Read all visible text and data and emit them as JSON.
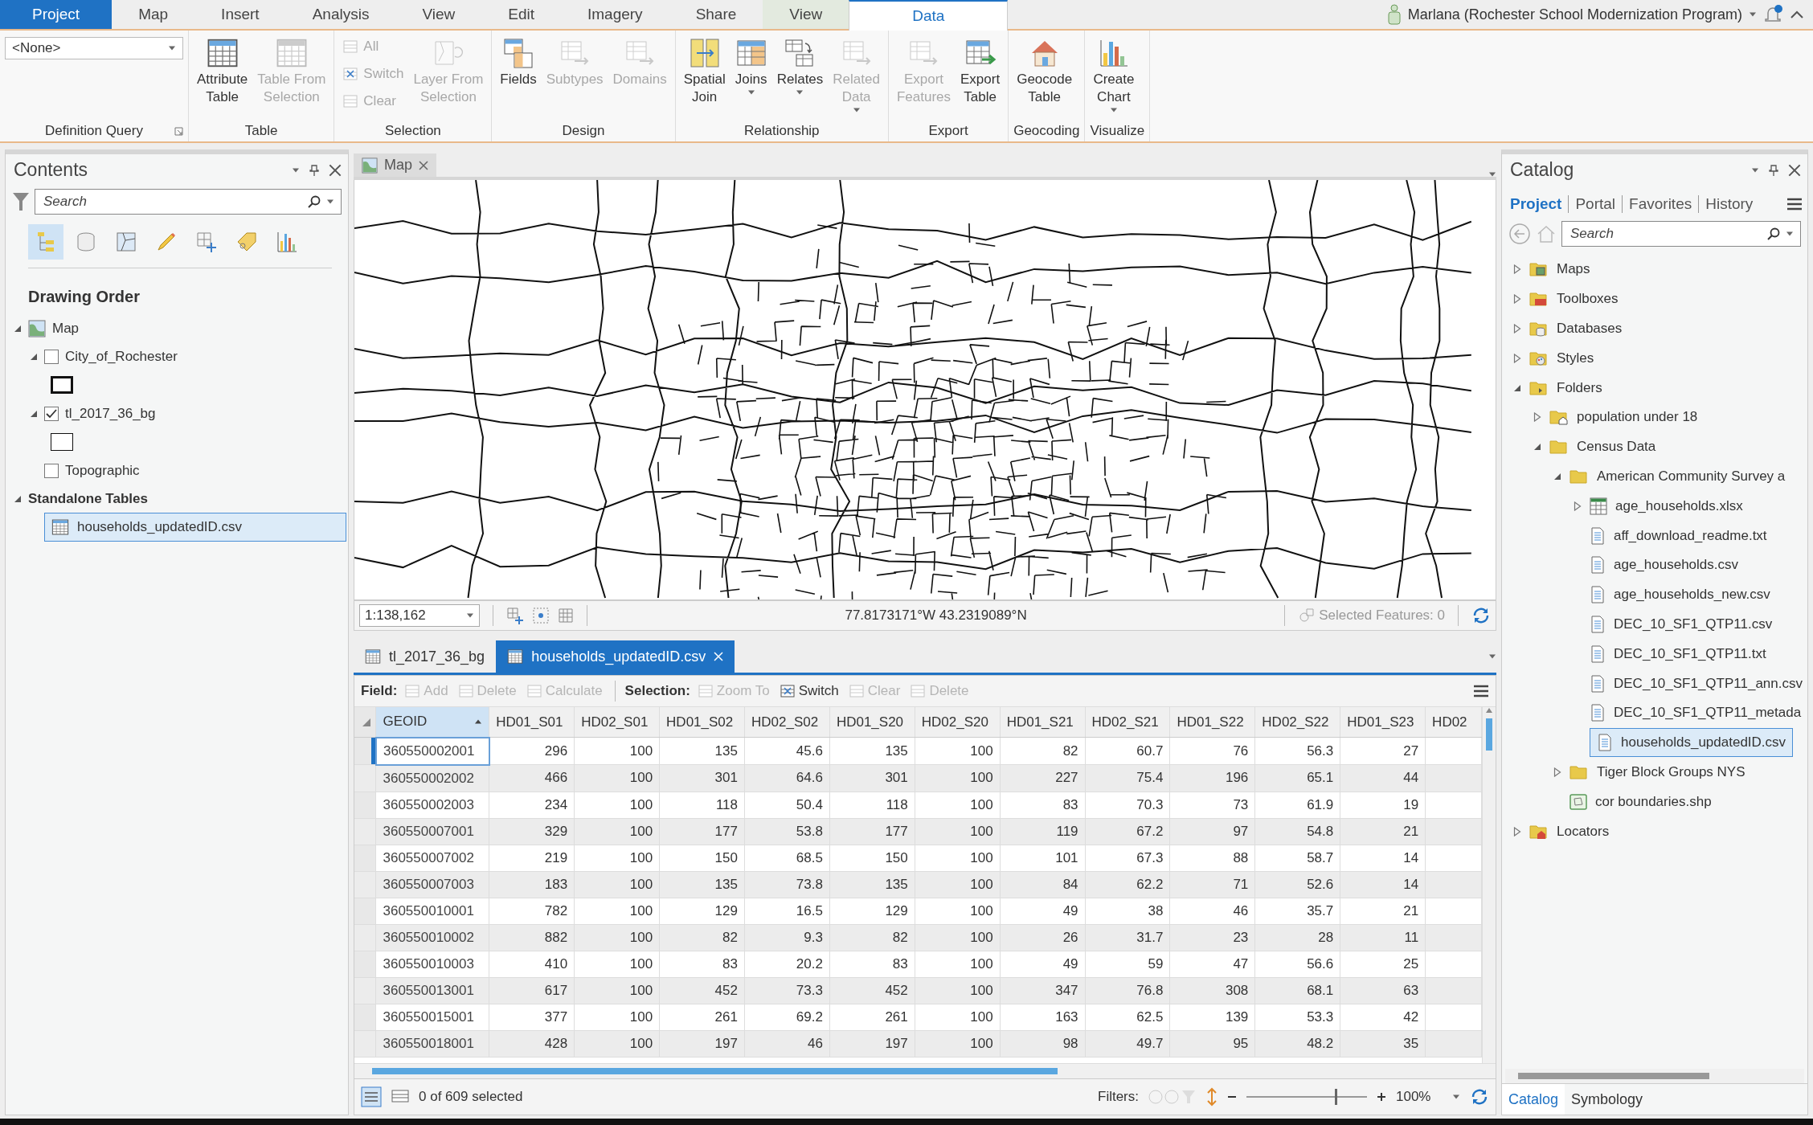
{
  "ribbon_tabs": [
    {
      "label": "Project",
      "kind": "file",
      "selected": false
    },
    {
      "label": "Map",
      "kind": "normal",
      "selected": false
    },
    {
      "label": "Insert",
      "kind": "normal",
      "selected": false
    },
    {
      "label": "Analysis",
      "kind": "normal",
      "selected": false
    },
    {
      "label": "View",
      "kind": "normal",
      "selected": false
    },
    {
      "label": "Edit",
      "kind": "normal",
      "selected": false
    },
    {
      "label": "Imagery",
      "kind": "normal",
      "selected": false
    },
    {
      "label": "Share",
      "kind": "normal",
      "selected": false
    },
    {
      "label": "View",
      "kind": "contextual",
      "selected": false
    },
    {
      "label": "Data",
      "kind": "contextual",
      "selected": true
    }
  ],
  "user": {
    "name": "Marlana (Rochester School Modernization Program)",
    "notification": true
  },
  "ribbon_groups": [
    {
      "label": "Definition Query",
      "launcher": true,
      "controls": [
        {
          "kind": "dropdown",
          "value": "<None>"
        }
      ]
    },
    {
      "label": "Table",
      "controls": [
        {
          "kind": "large",
          "lines": [
            "Attribute",
            "Table"
          ],
          "disabled": false
        },
        {
          "kind": "large",
          "lines": [
            "Table From",
            "Selection"
          ],
          "disabled": true
        }
      ]
    },
    {
      "label": "Selection",
      "controls": [
        {
          "kind": "stack",
          "items": [
            {
              "label": "All",
              "disabled": true
            },
            {
              "label": "Switch",
              "disabled": true
            },
            {
              "label": "Clear",
              "disabled": true
            }
          ]
        },
        {
          "kind": "large",
          "lines": [
            "Layer From",
            "Selection"
          ],
          "disabled": true
        }
      ]
    },
    {
      "label": "Design",
      "controls": [
        {
          "kind": "large",
          "lines": [
            "Fields"
          ],
          "disabled": false
        },
        {
          "kind": "large",
          "lines": [
            "Subtypes"
          ],
          "disabled": true
        },
        {
          "kind": "large",
          "lines": [
            "Domains"
          ],
          "disabled": true
        }
      ]
    },
    {
      "label": "Relationship",
      "controls": [
        {
          "kind": "large",
          "lines": [
            "Spatial",
            "Join"
          ],
          "disabled": false
        },
        {
          "kind": "large",
          "lines": [
            "Joins"
          ],
          "disabled": false,
          "menu": true
        },
        {
          "kind": "large",
          "lines": [
            "Relates"
          ],
          "disabled": false,
          "menu": true
        },
        {
          "kind": "large",
          "lines": [
            "Related",
            "Data"
          ],
          "disabled": true,
          "menu": true
        }
      ]
    },
    {
      "label": "Export",
      "controls": [
        {
          "kind": "large",
          "lines": [
            "Export",
            "Features"
          ],
          "disabled": true
        },
        {
          "kind": "large",
          "lines": [
            "Export",
            "Table"
          ],
          "disabled": false
        }
      ]
    },
    {
      "label": "Geocoding",
      "controls": [
        {
          "kind": "large",
          "lines": [
            "Geocode",
            "Table"
          ],
          "disabled": false
        }
      ]
    },
    {
      "label": "Visualize",
      "controls": [
        {
          "kind": "large",
          "lines": [
            "Create",
            "Chart"
          ],
          "disabled": false,
          "menu": true
        }
      ]
    }
  ],
  "contents": {
    "title": "Contents",
    "search": {
      "placeholder": "Search"
    },
    "view_tabs": [
      {
        "selected": true
      },
      {
        "selected": false
      },
      {
        "selected": false
      },
      {
        "selected": false
      },
      {
        "selected": false
      },
      {
        "selected": false
      },
      {
        "selected": false
      }
    ],
    "heading": "Drawing Order",
    "tree": [
      {
        "label": "Map",
        "kind": "map",
        "expanded": true,
        "selected": false,
        "children": [
          {
            "label": "City_of_Rochester",
            "kind": "layer",
            "expanded": true,
            "checked": false,
            "outline_bold": true,
            "selected": false
          },
          {
            "label": "tl_2017_36_bg",
            "kind": "layer",
            "expanded": true,
            "checked": true,
            "outline_bold": false,
            "selected": false
          },
          {
            "label": "Topographic",
            "kind": "basemap",
            "checked": false,
            "selected": false
          }
        ]
      },
      {
        "label": "Standalone Tables",
        "kind": "group",
        "expanded": true,
        "selected": false,
        "children": [
          {
            "label": "households_updatedID.csv",
            "kind": "table",
            "selected": true
          }
        ]
      }
    ]
  },
  "map": {
    "tab": {
      "label": "Map"
    },
    "scale": "1:138,162",
    "coordinates": "77.8173171°W 43.2319089°N",
    "selected_features": "Selected Features: 0",
    "kind": "picture"
  },
  "table": {
    "tabs": [
      {
        "label": "tl_2017_36_bg",
        "selected": false
      },
      {
        "label": "households_updatedID.csv",
        "selected": true
      }
    ],
    "toolbar": {
      "field_label": "Field:",
      "field_buttons": [
        {
          "label": "Add",
          "disabled": true
        },
        {
          "label": "Delete",
          "disabled": true
        },
        {
          "label": "Calculate",
          "disabled": true
        }
      ],
      "selection_label": "Selection:",
      "selection_buttons": [
        {
          "label": "Zoom To",
          "disabled": true
        },
        {
          "label": "Switch",
          "disabled": false
        },
        {
          "label": "Clear",
          "disabled": true
        },
        {
          "label": "Delete",
          "disabled": true
        }
      ]
    },
    "columns": [
      {
        "label": "GEOID",
        "sorted": true
      },
      {
        "label": "HD01_S01",
        "sorted": false
      },
      {
        "label": "HD02_S01",
        "sorted": false
      },
      {
        "label": "HD01_S02",
        "sorted": false
      },
      {
        "label": "HD02_S02",
        "sorted": false
      },
      {
        "label": "HD01_S20",
        "sorted": false
      },
      {
        "label": "HD02_S20",
        "sorted": false
      },
      {
        "label": "HD01_S21",
        "sorted": false
      },
      {
        "label": "HD02_S21",
        "sorted": false
      },
      {
        "label": "HD01_S22",
        "sorted": false
      },
      {
        "label": "HD02_S22",
        "sorted": false
      },
      {
        "label": "HD01_S23",
        "sorted": false
      },
      {
        "label": "HD02",
        "sorted": false
      }
    ],
    "rows": [
      {
        "current": true,
        "cells": [
          "360550002001",
          "296",
          "100",
          "135",
          "45.6",
          "135",
          "100",
          "82",
          "60.7",
          "76",
          "56.3",
          "27"
        ]
      },
      {
        "current": false,
        "cells": [
          "360550002002",
          "466",
          "100",
          "301",
          "64.6",
          "301",
          "100",
          "227",
          "75.4",
          "196",
          "65.1",
          "44"
        ]
      },
      {
        "current": false,
        "cells": [
          "360550002003",
          "234",
          "100",
          "118",
          "50.4",
          "118",
          "100",
          "83",
          "70.3",
          "73",
          "61.9",
          "19"
        ]
      },
      {
        "current": false,
        "cells": [
          "360550007001",
          "329",
          "100",
          "177",
          "53.8",
          "177",
          "100",
          "119",
          "67.2",
          "97",
          "54.8",
          "21"
        ]
      },
      {
        "current": false,
        "cells": [
          "360550007002",
          "219",
          "100",
          "150",
          "68.5",
          "150",
          "100",
          "101",
          "67.3",
          "88",
          "58.7",
          "14"
        ]
      },
      {
        "current": false,
        "cells": [
          "360550007003",
          "183",
          "100",
          "135",
          "73.8",
          "135",
          "100",
          "84",
          "62.2",
          "71",
          "52.6",
          "14"
        ]
      },
      {
        "current": false,
        "cells": [
          "360550010001",
          "782",
          "100",
          "129",
          "16.5",
          "129",
          "100",
          "49",
          "38",
          "46",
          "35.7",
          "21"
        ]
      },
      {
        "current": false,
        "cells": [
          "360550010002",
          "882",
          "100",
          "82",
          "9.3",
          "82",
          "100",
          "26",
          "31.7",
          "23",
          "28",
          "11"
        ]
      },
      {
        "current": false,
        "cells": [
          "360550010003",
          "410",
          "100",
          "83",
          "20.2",
          "83",
          "100",
          "49",
          "59",
          "47",
          "56.6",
          "25"
        ]
      },
      {
        "current": false,
        "cells": [
          "360550013001",
          "617",
          "100",
          "452",
          "73.3",
          "452",
          "100",
          "347",
          "76.8",
          "308",
          "68.1",
          "63"
        ]
      },
      {
        "current": false,
        "cells": [
          "360550015001",
          "377",
          "100",
          "261",
          "69.2",
          "261",
          "100",
          "163",
          "62.5",
          "139",
          "53.3",
          "42"
        ]
      },
      {
        "current": false,
        "cells": [
          "360550018001",
          "428",
          "100",
          "197",
          "46",
          "197",
          "100",
          "98",
          "49.7",
          "95",
          "48.2",
          "35"
        ]
      }
    ],
    "footer": {
      "selected": "0 of 609 selected",
      "filters_label": "Filters:",
      "zoom": {
        "level": 0.73
      },
      "zoom_value": "100%"
    }
  },
  "catalog": {
    "title": "Catalog",
    "tabs": [
      {
        "label": "Project",
        "selected": true
      },
      {
        "label": "Portal",
        "selected": false
      },
      {
        "label": "Favorites",
        "selected": false
      },
      {
        "label": "History",
        "selected": false
      }
    ],
    "search": {
      "placeholder": "Search"
    },
    "tree": [
      {
        "label": "Maps",
        "kind": "maps",
        "expanded": false,
        "selected": false
      },
      {
        "label": "Toolboxes",
        "kind": "toolboxes",
        "expanded": false,
        "selected": false
      },
      {
        "label": "Databases",
        "kind": "databases",
        "expanded": false,
        "selected": false
      },
      {
        "label": "Styles",
        "kind": "styles",
        "expanded": false,
        "selected": false
      },
      {
        "label": "Folders",
        "kind": "folders",
        "expanded": true,
        "selected": false,
        "children": [
          {
            "label": "population under 18",
            "kind": "home_folder",
            "expanded": false,
            "selected": false
          },
          {
            "label": "Census Data",
            "kind": "folder",
            "expanded": true,
            "selected": false,
            "children": [
              {
                "label": "American Community Survey a",
                "kind": "folder",
                "expanded": true,
                "selected": false,
                "children": [
                  {
                    "label": "age_households.xlsx",
                    "kind": "excel",
                    "expanded": false,
                    "selected": false
                  },
                  {
                    "label": "aff_download_readme.txt",
                    "kind": "text",
                    "selected": false
                  },
                  {
                    "label": "age_households.csv",
                    "kind": "text",
                    "selected": false
                  },
                  {
                    "label": "age_households_new.csv",
                    "kind": "text",
                    "selected": false
                  },
                  {
                    "label": "DEC_10_SF1_QTP11.csv",
                    "kind": "text",
                    "selected": false
                  },
                  {
                    "label": "DEC_10_SF1_QTP11.txt",
                    "kind": "text",
                    "selected": false
                  },
                  {
                    "label": "DEC_10_SF1_QTP11_ann.csv",
                    "kind": "text",
                    "selected": false
                  },
                  {
                    "label": "DEC_10_SF1_QTP11_metada",
                    "kind": "text",
                    "selected": false
                  },
                  {
                    "label": "households_updatedID.csv",
                    "kind": "text",
                    "selected": true
                  }
                ]
              },
              {
                "label": "Tiger Block Groups NYS",
                "kind": "folder",
                "expanded": false,
                "selected": false
              },
              {
                "label": "cor boundaries.shp",
                "kind": "shapefile",
                "selected": false
              }
            ]
          }
        ]
      },
      {
        "label": "Locators",
        "kind": "locators",
        "expanded": false,
        "selected": false
      }
    ],
    "bottom_tabs": [
      {
        "label": "Catalog",
        "selected": true
      },
      {
        "label": "Symbology",
        "selected": false
      }
    ]
  }
}
